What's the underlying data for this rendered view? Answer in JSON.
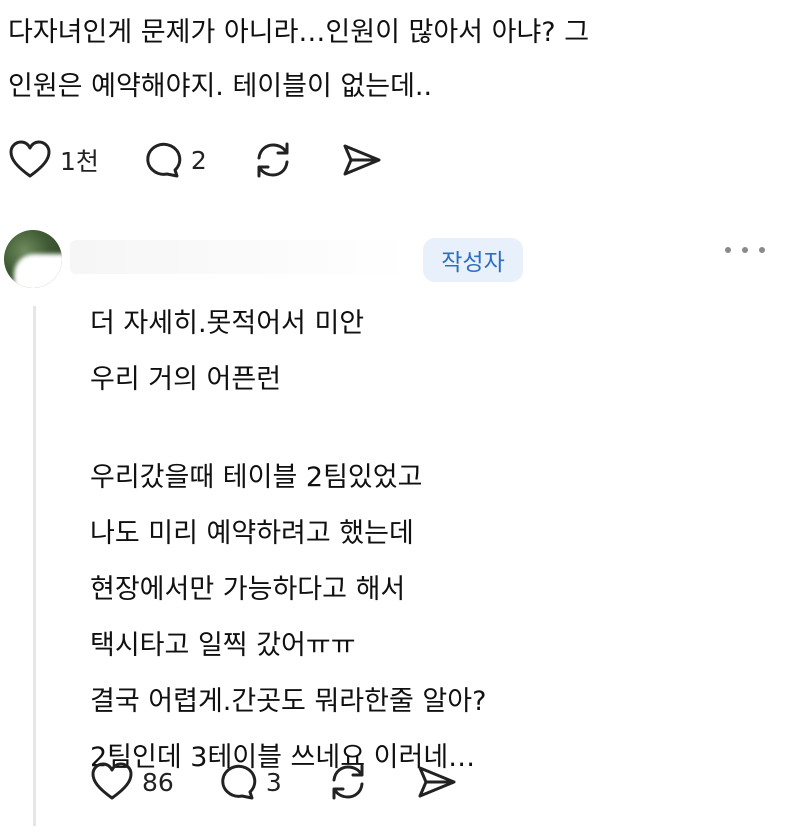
{
  "post": {
    "text": "다자녀인게 문제가 아니라…인원이 많아서 아냐? 그\n인원은 예약해야지. 테이블이 없는데..",
    "likes": "1천",
    "comments": "2"
  },
  "reply": {
    "author_badge": "작성자",
    "lines_a": [
      "더 자세히.못적어서 미안",
      "우리 거의 어픈런"
    ],
    "lines_b": [
      "우리갔을때 테이블 2팀있었고",
      "나도 미리 예약하려고 했는데",
      "현장에서만 가능하다고 해서",
      "택시타고 일찍 갔어ㅠㅠ",
      "결국 어렵게.간곳도 뭐라한줄 알아?",
      "2팀인데 3테이블 쓰네요 이러네…"
    ],
    "likes": "86",
    "comments": "3"
  },
  "icons": {
    "like": "heart-icon",
    "comment": "comment-bubble-icon",
    "repost": "repost-icon",
    "share": "send-icon",
    "more": "more-dots-icon"
  },
  "colors": {
    "badge_bg": "#e8f1fb",
    "badge_text": "#2d6fbf",
    "thread_line": "#e6e6e6"
  }
}
